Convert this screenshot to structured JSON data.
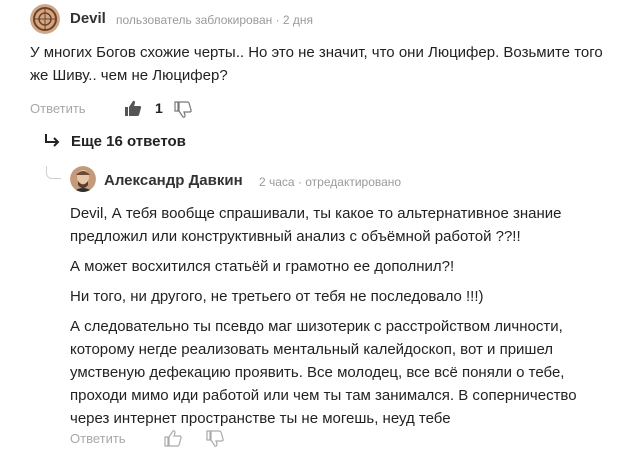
{
  "comment1": {
    "author": "Devil",
    "meta": "пользователь заблокирован · 2 дня",
    "text": "У многих Богов схожие черты.. Но это не значит, что они Люцифер. Возьмите того же Шиву.. чем не Люцифер?",
    "reply_label": "Ответить",
    "like_count": "1",
    "icons": [
      "avatar",
      "thumbs-up-icon",
      "thumbs-down-icon"
    ]
  },
  "more_replies": {
    "label": "Еще 16 ответов",
    "icon": "reply-arrow-icon"
  },
  "comment2": {
    "author": "Александр Давкин",
    "meta": "2 часа · отредактировано",
    "paragraphs": [
      "Devil, А тебя вообще спрашивали, ты какое то альтернативное знание предложил или конструктивный анализ с объёмной работой ??!!",
      "А может восхитился статьёй и грамотно ее дополнил?!",
      "Ни того, ни другого, не третьего от тебя не последовало !!!)",
      "А следовательно ты псевдо маг шизотерик с расстройством личности, которому негде реализовать ментальный калейдоскоп, вот и пришел умственую дефекацию проявить. Все молодец, все всё поняли о тебе, проходи мимо иди работой или чем ты там занимался. В соперничество через интернет пространстве ты не могешь, неуд тебе"
    ],
    "reply_label": "Ответить"
  },
  "colors": {
    "text": "#222222",
    "meta": "#9a9a9a",
    "reply": "#a8a8a8",
    "background": "#ffffff"
  }
}
